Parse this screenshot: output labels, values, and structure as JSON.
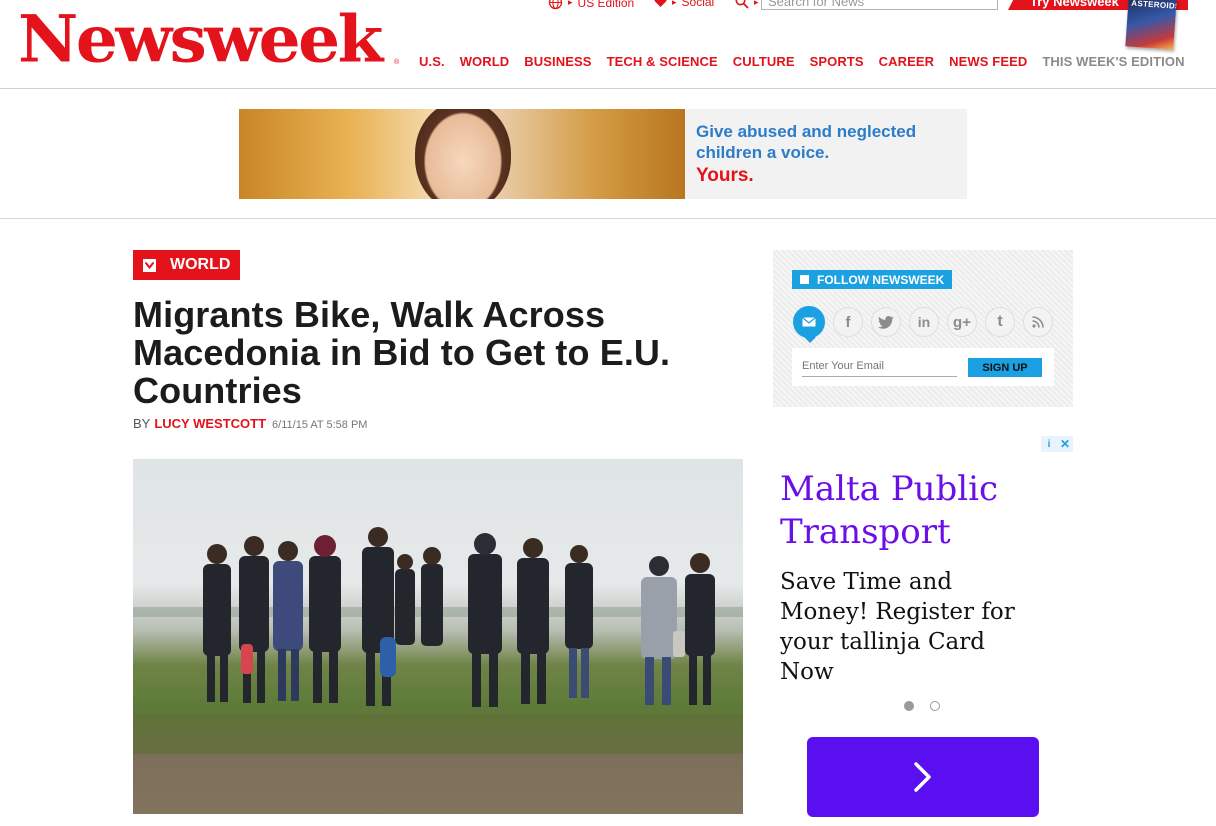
{
  "brand": {
    "logo_text": "Newsweek",
    "logo_dot": "®",
    "accent": "#e3121b"
  },
  "utility": {
    "edition_label": "US Edition",
    "social_label": "Social",
    "search_placeholder": "Search for News",
    "try_label": "Try Newsweek",
    "magazine_cover_text": "ASTEROIDS"
  },
  "nav": {
    "items": [
      {
        "label": "U.S."
      },
      {
        "label": "WORLD"
      },
      {
        "label": "BUSINESS"
      },
      {
        "label": "TECH & SCIENCE"
      },
      {
        "label": "SPORTS"
      },
      {
        "label": "CAREER"
      },
      {
        "label": "NEWS FEED"
      },
      {
        "label": "THIS WEEK'S EDITION"
      }
    ],
    "culture_label": "CULTURE"
  },
  "banner_ad": {
    "line1": "Give abused and neglected",
    "line2": "children a voice.",
    "line3": "Yours."
  },
  "article": {
    "section": "WORLD",
    "title": "Migrants Bike, Walk Across Macedonia in Bid to Get to E.U. Countries",
    "by": "BY",
    "author": "LUCY WESTCOTT",
    "date": "6/11/15 AT 5:58 PM"
  },
  "follow": {
    "title": "FOLLOW NEWSWEEK",
    "email_placeholder": "Enter Your Email",
    "signup_label": "SIGN UP",
    "social_icons": [
      "mail-icon",
      "facebook-icon",
      "twitter-icon",
      "linkedin-icon",
      "google-plus-icon",
      "tumblr-icon",
      "rss-icon"
    ]
  },
  "side_ad": {
    "adchoice_i": "i",
    "adchoice_x": "✕",
    "title": "Malta Public Transport",
    "body": "Save Time and Money! Register for your tallinja Card Now",
    "accent": "#5a0ff0"
  }
}
